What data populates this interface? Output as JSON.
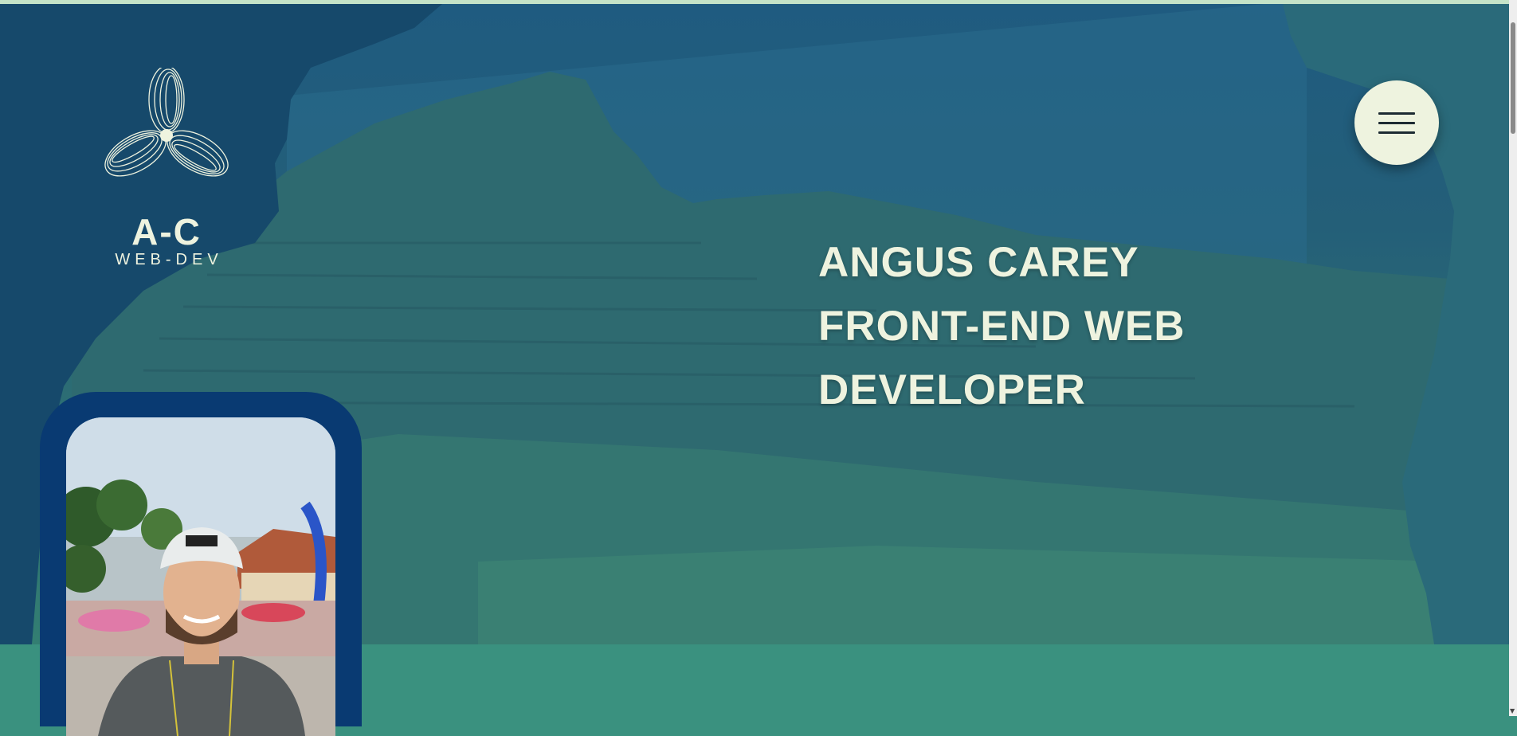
{
  "brand": {
    "name": "A-C",
    "tagline": "WEB-DEV"
  },
  "header": {
    "menu_icon": "hamburger-icon"
  },
  "hero": {
    "headline_lines": [
      "ANGUS CAREY",
      "FRONT-END WEB",
      "DEVELOPER"
    ]
  },
  "colors": {
    "text_light": "#eef3df",
    "portrait_frame": "#093a72",
    "band": "#3a917f",
    "overlay_top": "#1f5b80"
  }
}
